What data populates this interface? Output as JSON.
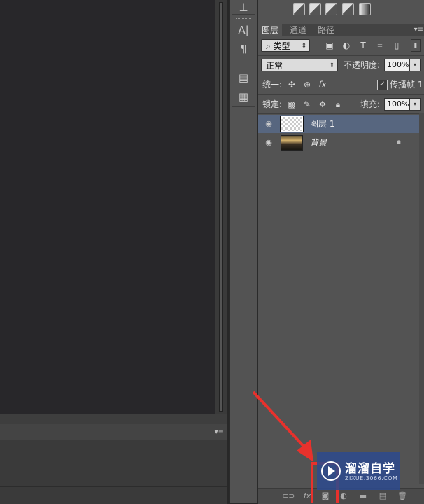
{
  "panel": {
    "tabs": [
      "图层",
      "通道",
      "路径"
    ],
    "filter_kind": "类型",
    "blend_mode": "正常",
    "opacity_label": "不透明度:",
    "opacity_value": "100%",
    "unify_label": "统一:",
    "propagate_label": "传播帧 1",
    "lock_label": "锁定:",
    "fill_label": "填充:",
    "fill_value": "100%",
    "fx_label": "fx",
    "layers": [
      {
        "name": "图层 1",
        "selected": true,
        "thumbnail": "transparent"
      },
      {
        "name": "背景",
        "selected": false,
        "thumbnail": "photo",
        "locked": true
      }
    ]
  },
  "footer": {
    "fx_label": "fx"
  },
  "watermark": {
    "brand": "溜溜自学",
    "url": "ZIXUE.3066.COM"
  },
  "colors": {
    "selection": "#57667f",
    "highlight": "#e8312c",
    "watermark": "#2e4a8c"
  }
}
